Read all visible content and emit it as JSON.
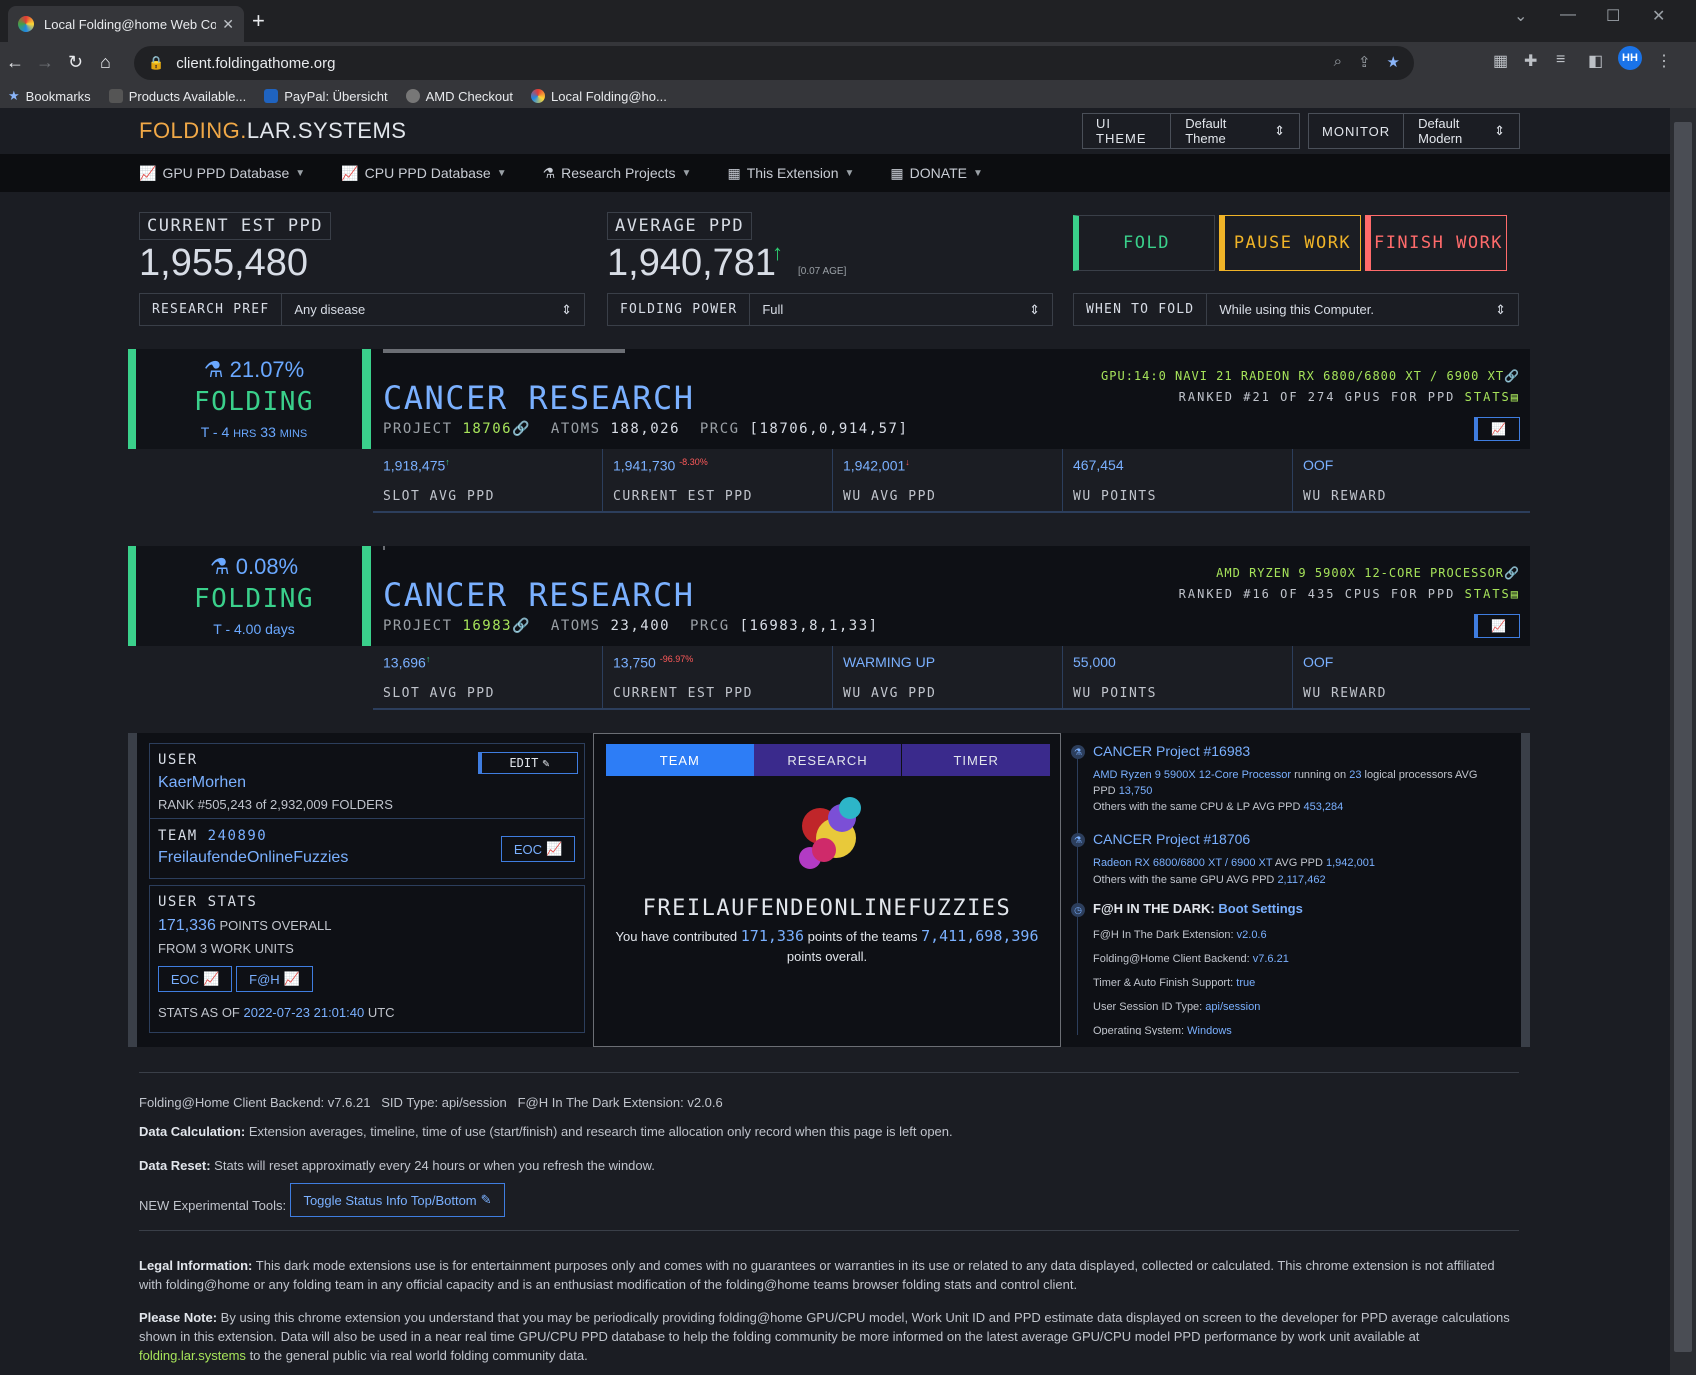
{
  "browser": {
    "tab_title": "Local Folding@home Web Contr",
    "url": "client.foldingathome.org",
    "profile_initials": "HH",
    "bookmarks": [
      "Bookmarks",
      "Products Available...",
      "PayPal: Übersicht",
      "AMD Checkout",
      "Local Folding@ho..."
    ]
  },
  "site": {
    "logo_part1": "FOLDING.",
    "logo_part2": "LAR.SYSTEMS",
    "ui_theme_label": "UI THEME",
    "ui_theme_value": "Default Theme",
    "monitor_label": "MONITOR",
    "monitor_value": "Default Modern"
  },
  "menu": [
    "GPU PPD Database",
    "CPU PPD Database",
    "Research Projects",
    "This Extension",
    "DONATE"
  ],
  "stats": {
    "current_label": "CURRENT EST PPD",
    "current_value": "1,955,480",
    "average_label": "AVERAGE PPD",
    "average_value": "1,940,781",
    "average_note": "[0.07 AGE]"
  },
  "controls": {
    "fold": "FOLD",
    "pause": "PAUSE WORK",
    "finish": "FINISH WORK",
    "research_pref_label": "RESEARCH PREF",
    "research_pref_value": "Any disease",
    "folding_power_label": "FOLDING POWER",
    "folding_power_value": "Full",
    "when_label": "WHEN TO FOLD",
    "when_value": "While using this Computer."
  },
  "slots": [
    {
      "percent": "21.07%",
      "progress_fraction": 0.2107,
      "state": "FOLDING",
      "eta_prefix": "T - 4",
      "eta_h": "HRS",
      "eta_m_val": "33",
      "eta_m": "MINS",
      "title": "CANCER RESEARCH",
      "project_label": "PROJECT",
      "project": "18706",
      "atoms_label": "ATOMS",
      "atoms": "188,026",
      "prcg_label": "PRCG",
      "prcg": "[18706,0,914,57]",
      "device": "GPU:14:0 NAVI 21 RADEON RX 6800/6800 XT / 6900 XT",
      "rank": "RANKED #21 OF 274 GPUS FOR PPD",
      "stats_link": "STATS",
      "cells": [
        {
          "value": "1,918,475",
          "sup": "↑",
          "label": "SLOT AVG PPD"
        },
        {
          "value": "1,941,730",
          "sup": "-8.30%",
          "label": "CURRENT EST PPD"
        },
        {
          "value": "1,942,001",
          "sup": "↓",
          "label": "WU AVG PPD"
        },
        {
          "value": "467,454",
          "sup": "",
          "label": "WU POINTS"
        },
        {
          "value": "OOF",
          "sup": "",
          "label": "WU REWARD"
        }
      ]
    },
    {
      "percent": "0.08%",
      "progress_fraction": 0.0008,
      "state": "FOLDING",
      "eta_prefix": "T - 4.00 days",
      "eta_h": "",
      "eta_m_val": "",
      "eta_m": "",
      "title": "CANCER RESEARCH",
      "project_label": "PROJECT",
      "project": "16983",
      "atoms_label": "ATOMS",
      "atoms": "23,400",
      "prcg_label": "PRCG",
      "prcg": "[16983,8,1,33]",
      "device": "AMD RYZEN 9 5900X 12-CORE PROCESSOR",
      "rank": "RANKED #16 OF 435 CPUS FOR PPD",
      "stats_link": "STATS",
      "cells": [
        {
          "value": "13,696",
          "sup": "↑",
          "label": "SLOT AVG PPD"
        },
        {
          "value": "13,750",
          "sup": "-96.97%",
          "label": "CURRENT EST PPD"
        },
        {
          "value": "WARMING UP",
          "sup": "",
          "label": "WU AVG PPD"
        },
        {
          "value": "55,000",
          "sup": "",
          "label": "WU POINTS"
        },
        {
          "value": "OOF",
          "sup": "",
          "label": "WU REWARD"
        }
      ]
    }
  ],
  "user": {
    "label": "USER",
    "edit": "EDIT",
    "name": "KaerMorhen",
    "rank": "RANK #505,243 of 2,932,009 FOLDERS",
    "team_label": "TEAM",
    "team_id": "240890",
    "team_name": "FreilaufendeOnlineFuzzies",
    "eoc": "EOC",
    "stats_label": "USER STATS",
    "points": "171,336",
    "points_suffix": "POINTS OVERALL",
    "work_units": "FROM 3 WORK UNITS",
    "fah": "F@H",
    "stats_as_of": "STATS AS OF",
    "stats_date": "2022-07-23 21:01:40",
    "stats_tz": "UTC"
  },
  "team_panel": {
    "tabs": [
      "TEAM",
      "RESEARCH",
      "TIMER"
    ],
    "team_name": "FREILAUFENDEONLINEFUZZIES",
    "contrib_prefix": "You have contributed",
    "contrib_points": "171,336",
    "contrib_mid": "points of the teams",
    "team_points": "7,411,698,396",
    "contrib_suffix": "points overall."
  },
  "info": {
    "p1_title": "CANCER Project #16983",
    "p1_line1_a": "AMD Ryzen 9 5900X 12-Core Processor",
    "p1_line1_b": "running on",
    "p1_line1_c": "23",
    "p1_line1_d": "logical processors AVG PPD",
    "p1_line1_e": "13,750",
    "p1_line2_a": "Others with the same CPU & LP AVG PPD",
    "p1_line2_b": "453,284",
    "p2_title": "CANCER Project #18706",
    "p2_line1_a": "Radeon RX 6800/6800 XT / 6900 XT",
    "p2_line1_b": "AVG PPD",
    "p2_line1_c": "1,942,001",
    "p2_line2_a": "Others with the same GPU AVG PPD",
    "p2_line2_b": "2,117,462",
    "dark_title": "F@H IN THE DARK:",
    "dark_link": "Boot Settings",
    "rows": [
      {
        "k": "F@H In The Dark Extension:",
        "v": "v2.0.6"
      },
      {
        "k": "Folding@Home Client Backend:",
        "v": "v7.6.21"
      },
      {
        "k": "Timer & Auto Finish Support:",
        "v": "true"
      },
      {
        "k": "User Session ID Type:",
        "v": "api/session"
      },
      {
        "k": "Operating System:",
        "v": "Windows"
      }
    ]
  },
  "footer": {
    "versions": "Folding@Home Client Backend: v7.6.21   SID Type: api/session   F@H In The Dark Extension: v2.0.6",
    "calc_b": "Data Calculation:",
    "calc": "Extension averages, timeline, time of use (start/finish) and research time allocation only record when this page is left open.",
    "reset_b": "Data Reset:",
    "reset": "Stats will reset approximatly every 24 hours or when you refresh the window.",
    "tools_b": "NEW Experimental Tools:",
    "tools_btn": "Toggle Status Info Top/Bottom",
    "legal_b": "Legal Information:",
    "legal": "This dark mode extensions use is for entertainment purposes only and comes with no guarantees or warranties in its use or related to any data displayed, collected or calculated. This chrome extension is not affiliated with folding@home or any folding team in any official capacity and is an enthusiast modification of the folding@home teams browser folding stats and control client.",
    "note_b": "Please Note:",
    "note": "By using this chrome extension you understand that you may be periodically providing folding@home GPU/CPU model, Work Unit ID and PPD estimate data displayed on screen to the developer for PPD average calculations shown in this extension. Data will also be used in a near real time GPU/CPU PPD database to help the folding community be more informed on the latest average GPU/CPU model PPD performance by work unit available at",
    "note_link": "folding.lar.systems",
    "note_end": "to the general public via real world folding community data."
  },
  "colors": {
    "accent_green": "#3ad08b",
    "accent_blue": "#7ab0ff",
    "lime": "#a6e35a",
    "pause": "#f0b428",
    "finish": "#ff6b6b"
  }
}
